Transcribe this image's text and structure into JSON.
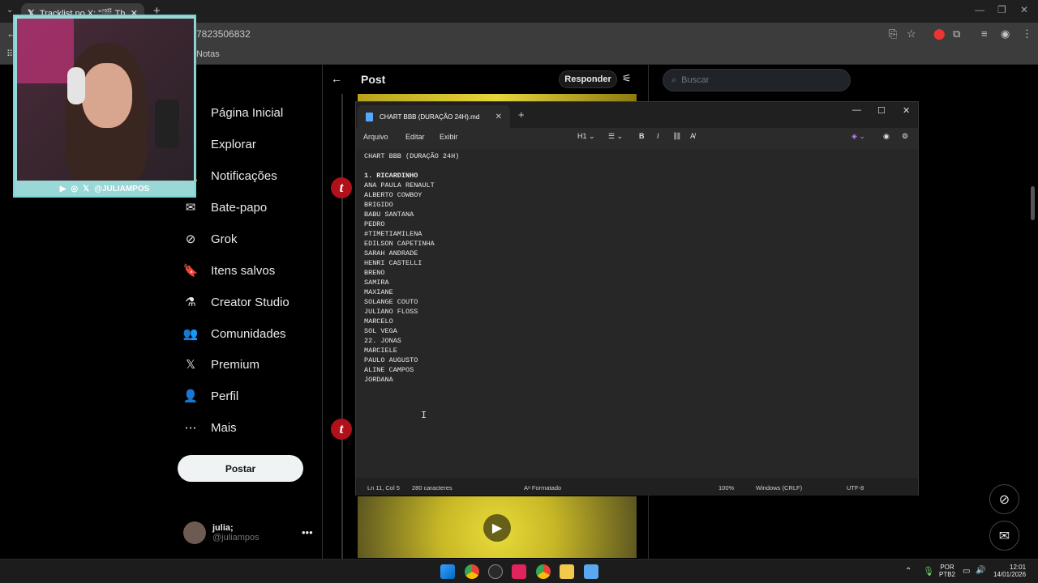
{
  "browser": {
    "tab_title": "Tracklist no X: \"🎬 Thread dos",
    "url": "7823506832",
    "bookmark": "Notas"
  },
  "x": {
    "nav": [
      {
        "label": "Página Inicial",
        "icon": "home-icon"
      },
      {
        "label": "Explorar",
        "icon": "explore-icon"
      },
      {
        "label": "Notificações",
        "icon": "bell-icon"
      },
      {
        "label": "Bate-papo",
        "icon": "mail-icon"
      },
      {
        "label": "Grok",
        "icon": "grok-icon"
      },
      {
        "label": "Itens salvos",
        "icon": "bookmark-icon"
      },
      {
        "label": "Creator Studio",
        "icon": "flask-icon"
      },
      {
        "label": "Comunidades",
        "icon": "communities-icon"
      },
      {
        "label": "Premium",
        "icon": "x-logo-icon"
      },
      {
        "label": "Perfil",
        "icon": "person-icon"
      },
      {
        "label": "Mais",
        "icon": "more-circle-icon"
      }
    ],
    "post_button": "Postar",
    "profile": {
      "name": "julia;",
      "handle": "@juliampos"
    },
    "header_title": "Post",
    "reply_button": "Responder",
    "search_placeholder": "Buscar",
    "avatar_letter": "t"
  },
  "webcam": {
    "handle": "@JULIAMPOS"
  },
  "notepad": {
    "tab_title": "CHART BBB (DURAÇÃO 24H).md",
    "menu": [
      "Arquivo",
      "Editar",
      "Exibir"
    ],
    "heading_select": "H1",
    "lines": [
      {
        "text": "CHART BBB (DURAÇÃO 24H)",
        "bold": false
      },
      {
        "text": "",
        "bold": false
      },
      {
        "text": "1. RICARDINHO",
        "bold": true
      },
      {
        "text": "ANA PAULA RENAULT",
        "bold": false
      },
      {
        "text": "ALBERTO COWBOY",
        "bold": false
      },
      {
        "text": "BRIGIDO",
        "bold": false
      },
      {
        "text": "BABU SANTANA",
        "bold": false
      },
      {
        "text": "PEDRO",
        "bold": false
      },
      {
        "text": "#TIMETIAMILENA",
        "bold": false
      },
      {
        "text": "EDILSON CAPETINHA",
        "bold": false
      },
      {
        "text": "SARAH ANDRADE",
        "bold": false
      },
      {
        "text": "HENRI CASTELLI",
        "bold": false
      },
      {
        "text": "BRENO",
        "bold": false
      },
      {
        "text": "SAMIRA",
        "bold": false
      },
      {
        "text": "MAXIANE",
        "bold": false
      },
      {
        "text": "SOLANGE COUTO",
        "bold": false
      },
      {
        "text": "JULIANO FLOSS",
        "bold": false
      },
      {
        "text": "MARCELO",
        "bold": false
      },
      {
        "text": "SOL VEGA",
        "bold": false
      },
      {
        "text": "22. JONAS",
        "bold": false
      },
      {
        "text": "MARCIELE",
        "bold": false
      },
      {
        "text": "PAULO AUGUSTO",
        "bold": false
      },
      {
        "text": "ALINE CAMPOS",
        "bold": false
      },
      {
        "text": "JORDANA",
        "bold": false
      }
    ],
    "status": {
      "position": "Ln 11, Col 5",
      "chars": "280 caracteres",
      "format": "Formatado",
      "zoom": "100%",
      "line_ending": "Windows (CRLF)",
      "encoding": "UTF-8"
    }
  },
  "taskbar": {
    "lang": "POR",
    "layout": "PTB2",
    "time": "12:01",
    "date": "14/01/2026"
  }
}
